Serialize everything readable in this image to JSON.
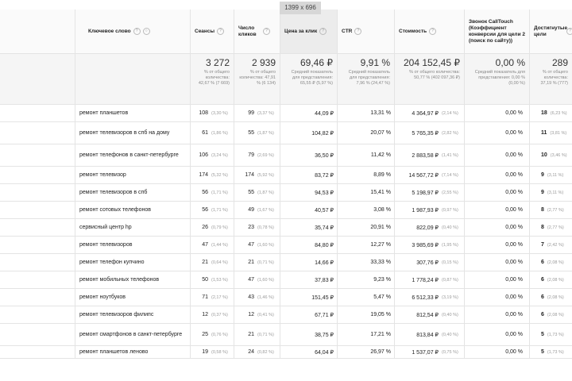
{
  "tooltip": "1399 x 696",
  "header": {
    "keyword": "Ключевое слово",
    "sessions": "Сеансы",
    "clicks": "Число кликов",
    "cpc": "Цена за клик",
    "ctr": "CTR",
    "cost": "Стоимость",
    "calltouch": "Звонок CallTouch (Коэффициент конверсии для цели 2 (поиск по сайту))",
    "goals": "Достигнутые цели"
  },
  "totals": {
    "sessions": {
      "value": "3 272",
      "sub": "% от общего количества: 42,67 % (7 669)"
    },
    "clicks": {
      "value": "2 939",
      "sub": "% от общего количества: 47,91 % (6 134)"
    },
    "cpc": {
      "value": "69,46 ₽",
      "sub": "Средний показатель для представления: 65,55 ₽ (5,97 %)"
    },
    "ctr": {
      "value": "9,91 %",
      "sub": "Средний показатель для представления: 7,96 % (24,47 %)"
    },
    "cost": {
      "value": "204 152,45 ₽",
      "sub": "% от общего количества: 50,77 % (402 097,36 ₽)"
    },
    "calltouch": {
      "value": "0,00 %",
      "sub": "Средний показатель для представления: 0,00 % (0,00 %)"
    },
    "goals": {
      "value": "289",
      "sub": "% от общего количества: 37,19 % (777)"
    }
  },
  "rows": [
    {
      "kw": "ремонт планшетов",
      "s": "108",
      "sp": "(3,30 %)",
      "c": "99",
      "cp": "(3,37 %)",
      "cpc": "44,09 ₽",
      "ctr": "13,31 %",
      "cost": "4 364,97 ₽",
      "costp": "(2,14 %)",
      "ct": "0,00 %",
      "g": "18",
      "gp": "(6,23 %)"
    },
    {
      "kw": "ремонт телевизоров в спб на дому",
      "s": "61",
      "sp": "(1,86 %)",
      "c": "55",
      "cp": "(1,87 %)",
      "cpc": "104,82 ₽",
      "ctr": "20,07 %",
      "cost": "5 765,35 ₽",
      "costp": "(2,82 %)",
      "ct": "0,00 %",
      "g": "11",
      "gp": "(3,81 %)"
    },
    {
      "kw": "ремонт телефонов в санкт-петербурге",
      "s": "106",
      "sp": "(3,24 %)",
      "c": "79",
      "cp": "(2,69 %)",
      "cpc": "36,50 ₽",
      "ctr": "11,42 %",
      "cost": "2 883,58 ₽",
      "costp": "(1,41 %)",
      "ct": "0,00 %",
      "g": "10",
      "gp": "(3,46 %)"
    },
    {
      "kw": "ремонт телевизор",
      "s": "174",
      "sp": "(5,32 %)",
      "c": "174",
      "cp": "(5,92 %)",
      "cpc": "83,72 ₽",
      "ctr": "8,89 %",
      "cost": "14 567,72 ₽",
      "costp": "(7,14 %)",
      "ct": "0,00 %",
      "g": "9",
      "gp": "(3,11 %)"
    },
    {
      "kw": "ремонт телевизоров в спб",
      "s": "56",
      "sp": "(1,71 %)",
      "c": "55",
      "cp": "(1,87 %)",
      "cpc": "94,53 ₽",
      "ctr": "15,41 %",
      "cost": "5 198,97 ₽",
      "costp": "(2,55 %)",
      "ct": "0,00 %",
      "g": "9",
      "gp": "(3,11 %)"
    },
    {
      "kw": "ремонт сотовых телефонов",
      "s": "56",
      "sp": "(1,71 %)",
      "c": "49",
      "cp": "(1,67 %)",
      "cpc": "40,57 ₽",
      "ctr": "3,08 %",
      "cost": "1 987,93 ₽",
      "costp": "(0,97 %)",
      "ct": "0,00 %",
      "g": "8",
      "gp": "(2,77 %)"
    },
    {
      "kw": "сервисный центр hp",
      "s": "26",
      "sp": "(0,79 %)",
      "c": "23",
      "cp": "(0,78 %)",
      "cpc": "35,74 ₽",
      "ctr": "20,91 %",
      "cost": "822,09 ₽",
      "costp": "(0,40 %)",
      "ct": "0,00 %",
      "g": "8",
      "gp": "(2,77 %)"
    },
    {
      "kw": "ремонт телевизоров",
      "s": "47",
      "sp": "(1,44 %)",
      "c": "47",
      "cp": "(1,60 %)",
      "cpc": "84,80 ₽",
      "ctr": "12,27 %",
      "cost": "3 985,69 ₽",
      "costp": "(1,95 %)",
      "ct": "0,00 %",
      "g": "7",
      "gp": "(2,42 %)"
    },
    {
      "kw": "ремонт телефон купчино",
      "s": "21",
      "sp": "(0,64 %)",
      "c": "21",
      "cp": "(0,71 %)",
      "cpc": "14,66 ₽",
      "ctr": "33,33 %",
      "cost": "307,76 ₽",
      "costp": "(0,15 %)",
      "ct": "0,00 %",
      "g": "6",
      "gp": "(2,08 %)"
    },
    {
      "kw": "ремонт мобильных телефонов",
      "s": "50",
      "sp": "(1,53 %)",
      "c": "47",
      "cp": "(1,60 %)",
      "cpc": "37,83 ₽",
      "ctr": "9,23 %",
      "cost": "1 778,24 ₽",
      "costp": "(0,87 %)",
      "ct": "0,00 %",
      "g": "6",
      "gp": "(2,08 %)"
    },
    {
      "kw": "ремонт ноутбуков",
      "s": "71",
      "sp": "(2,17 %)",
      "c": "43",
      "cp": "(1,46 %)",
      "cpc": "151,45 ₽",
      "ctr": "5,47 %",
      "cost": "6 512,33 ₽",
      "costp": "(3,19 %)",
      "ct": "0,00 %",
      "g": "6",
      "gp": "(2,08 %)"
    },
    {
      "kw": "ремонт телевизоров филипс",
      "s": "12",
      "sp": "(0,37 %)",
      "c": "12",
      "cp": "(0,41 %)",
      "cpc": "67,71 ₽",
      "ctr": "19,05 %",
      "cost": "812,54 ₽",
      "costp": "(0,40 %)",
      "ct": "0,00 %",
      "g": "6",
      "gp": "(2,08 %)"
    },
    {
      "kw": "ремонт смартфонов в санкт-петербурге",
      "s": "25",
      "sp": "(0,76 %)",
      "c": "21",
      "cp": "(0,71 %)",
      "cpc": "38,75 ₽",
      "ctr": "17,21 %",
      "cost": "813,84 ₽",
      "costp": "(0,40 %)",
      "ct": "0,00 %",
      "g": "5",
      "gp": "(1,73 %)"
    },
    {
      "kw": "ремонт планшетов леново",
      "s": "19",
      "sp": "(0,58 %)",
      "c": "24",
      "cp": "(0,82 %)",
      "cpc": "64,04 ₽",
      "ctr": "26,97 %",
      "cost": "1 537,07 ₽",
      "costp": "(0,75 %)",
      "ct": "0,00 %",
      "g": "5",
      "gp": "(1,73 %)"
    }
  ]
}
